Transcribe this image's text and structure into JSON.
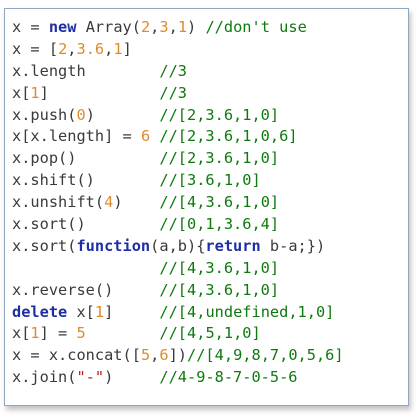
{
  "lines": [
    {
      "parts": [
        {
          "t": "x = ",
          "c": "txt"
        },
        {
          "t": "new",
          "c": "kw"
        },
        {
          "t": " Array(",
          "c": "txt"
        },
        {
          "t": "2",
          "c": "num"
        },
        {
          "t": ",",
          "c": "txt"
        },
        {
          "t": "3",
          "c": "num"
        },
        {
          "t": ",",
          "c": "txt"
        },
        {
          "t": "1",
          "c": "num"
        },
        {
          "t": ") ",
          "c": "txt"
        },
        {
          "t": "//don't use",
          "c": "cm"
        }
      ]
    },
    {
      "parts": [
        {
          "t": "x = [",
          "c": "txt"
        },
        {
          "t": "2",
          "c": "num"
        },
        {
          "t": ",",
          "c": "txt"
        },
        {
          "t": "3.6",
          "c": "num"
        },
        {
          "t": ",",
          "c": "txt"
        },
        {
          "t": "1",
          "c": "num"
        },
        {
          "t": "]",
          "c": "txt"
        }
      ]
    },
    {
      "parts": [
        {
          "t": "x.length        ",
          "c": "txt"
        },
        {
          "t": "//3",
          "c": "cm"
        }
      ]
    },
    {
      "parts": [
        {
          "t": "x[",
          "c": "txt"
        },
        {
          "t": "1",
          "c": "num"
        },
        {
          "t": "]            ",
          "c": "txt"
        },
        {
          "t": "//3",
          "c": "cm"
        }
      ]
    },
    {
      "parts": [
        {
          "t": "x.push(",
          "c": "txt"
        },
        {
          "t": "0",
          "c": "num"
        },
        {
          "t": ")       ",
          "c": "txt"
        },
        {
          "t": "//[2,3.6,1,0]",
          "c": "cm"
        }
      ]
    },
    {
      "parts": [
        {
          "t": "x[x.length] = ",
          "c": "txt"
        },
        {
          "t": "6",
          "c": "num"
        },
        {
          "t": " ",
          "c": "txt"
        },
        {
          "t": "//[2,3.6,1,0,6]",
          "c": "cm"
        }
      ]
    },
    {
      "parts": [
        {
          "t": "x.pop()         ",
          "c": "txt"
        },
        {
          "t": "//[2,3.6,1,0]",
          "c": "cm"
        }
      ]
    },
    {
      "parts": [
        {
          "t": "x.shift()       ",
          "c": "txt"
        },
        {
          "t": "//[3.6,1,0]",
          "c": "cm"
        }
      ]
    },
    {
      "parts": [
        {
          "t": "x.unshift(",
          "c": "txt"
        },
        {
          "t": "4",
          "c": "num"
        },
        {
          "t": ")    ",
          "c": "txt"
        },
        {
          "t": "//[4,3.6,1,0]",
          "c": "cm"
        }
      ]
    },
    {
      "parts": [
        {
          "t": "x.sort()        ",
          "c": "txt"
        },
        {
          "t": "//[0,1,3.6,4]",
          "c": "cm"
        }
      ]
    },
    {
      "parts": [
        {
          "t": "x.sort(",
          "c": "txt"
        },
        {
          "t": "function",
          "c": "kw"
        },
        {
          "t": "(a,b){",
          "c": "txt"
        },
        {
          "t": "return",
          "c": "kw"
        },
        {
          "t": " b-a;})",
          "c": "txt"
        }
      ]
    },
    {
      "parts": [
        {
          "t": "                ",
          "c": "txt"
        },
        {
          "t": "//[4,3.6,1,0]",
          "c": "cm"
        }
      ]
    },
    {
      "parts": [
        {
          "t": "x.reverse()     ",
          "c": "txt"
        },
        {
          "t": "//[4,3.6,1,0]",
          "c": "cm"
        }
      ]
    },
    {
      "parts": [
        {
          "t": "delete",
          "c": "kw"
        },
        {
          "t": " x[",
          "c": "txt"
        },
        {
          "t": "1",
          "c": "num"
        },
        {
          "t": "]     ",
          "c": "txt"
        },
        {
          "t": "//[4,undefined,1,0]",
          "c": "cm"
        }
      ]
    },
    {
      "parts": [
        {
          "t": "x[",
          "c": "txt"
        },
        {
          "t": "1",
          "c": "num"
        },
        {
          "t": "] = ",
          "c": "txt"
        },
        {
          "t": "5",
          "c": "num"
        },
        {
          "t": "        ",
          "c": "txt"
        },
        {
          "t": "//[4,5,1,0]",
          "c": "cm"
        }
      ]
    },
    {
      "parts": [
        {
          "t": "x = x.concat([",
          "c": "txt"
        },
        {
          "t": "5",
          "c": "num"
        },
        {
          "t": ",",
          "c": "txt"
        },
        {
          "t": "6",
          "c": "num"
        },
        {
          "t": "])",
          "c": "txt"
        },
        {
          "t": "//[4,9,8,7,0,5,6]",
          "c": "cm"
        }
      ]
    },
    {
      "parts": [
        {
          "t": "x.join(",
          "c": "txt"
        },
        {
          "t": "\"-\"",
          "c": "str"
        },
        {
          "t": ")     ",
          "c": "txt"
        },
        {
          "t": "//4-9-8-7-0-5-6",
          "c": "cm"
        }
      ]
    }
  ],
  "colors": {
    "text": "#3a3a3a",
    "keyword": "#1f2fa3",
    "number": "#e08a2a",
    "comment": "#0d7a0d",
    "string": "#c21a1a",
    "border": "#8fa8bf"
  }
}
